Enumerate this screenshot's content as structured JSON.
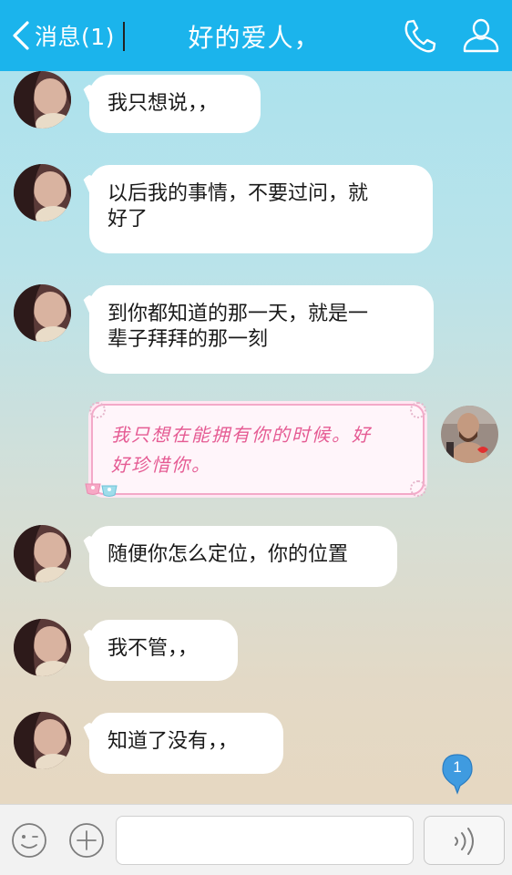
{
  "header": {
    "back_label": "消息(1)",
    "title": "好的爱人，",
    "background_color": "#1bb4ec"
  },
  "messages": [
    {
      "sender": "them",
      "text_lines": [
        "我只想说，，"
      ]
    },
    {
      "sender": "them",
      "text_lines": [
        "以后我的事情，不要过问，就",
        "好了"
      ]
    },
    {
      "sender": "them",
      "text_lines": [
        "到你都知道的那一天，就是一",
        "辈子拜拜的那一刻"
      ]
    },
    {
      "sender": "me",
      "text_lines": [
        "我只想在能拥有你的时候。好",
        "好珍惜你。"
      ]
    },
    {
      "sender": "them",
      "text_lines": [
        "随便你怎么定位，你的位置"
      ]
    },
    {
      "sender": "them",
      "text_lines": [
        "我不管，，"
      ]
    },
    {
      "sender": "them",
      "text_lines": [
        "知道了没有，，"
      ]
    }
  ],
  "unread_badge": {
    "count": "1"
  },
  "input_bar": {
    "value": "",
    "icons": [
      "emoji-icon",
      "plus-icon",
      "voice-icon"
    ]
  },
  "icons": {
    "back": "chevron-left-icon",
    "call": "phone-icon",
    "profile": "person-icon"
  }
}
